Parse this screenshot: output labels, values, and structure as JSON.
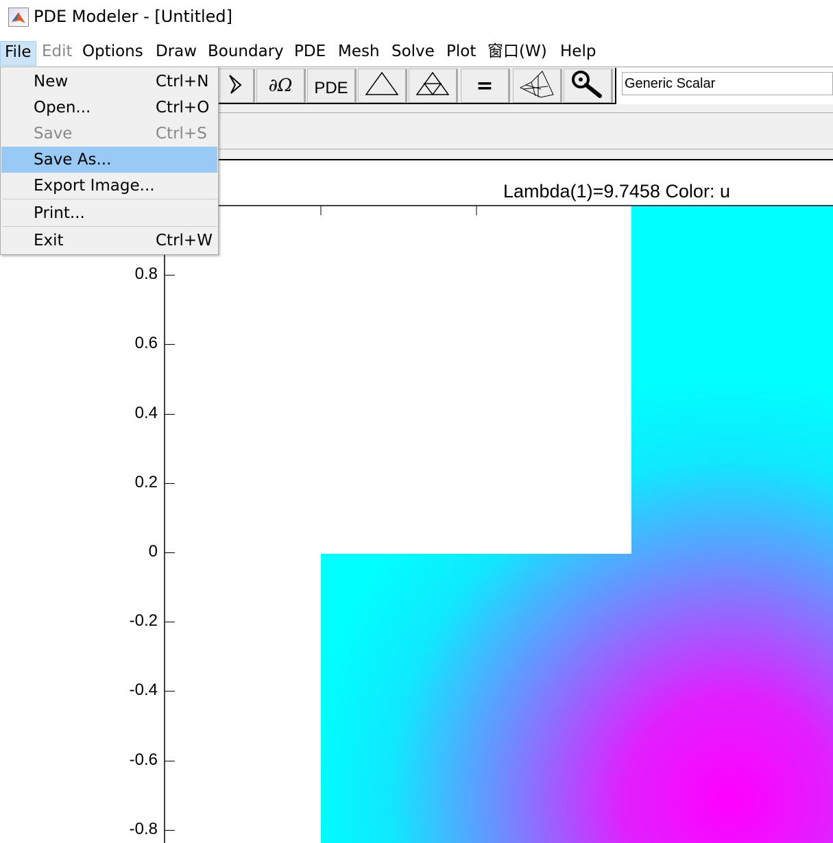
{
  "window": {
    "title": "PDE Modeler - [Untitled]"
  },
  "menubar": {
    "items": [
      {
        "label": "File",
        "state": "active"
      },
      {
        "label": "Edit",
        "state": "disabled"
      },
      {
        "label": "Options"
      },
      {
        "label": "Draw"
      },
      {
        "label": "Boundary"
      },
      {
        "label": "PDE"
      },
      {
        "label": "Mesh"
      },
      {
        "label": "Solve"
      },
      {
        "label": "Plot"
      },
      {
        "label": "窗口(W)"
      },
      {
        "label": "Help"
      }
    ]
  },
  "file_menu": {
    "items": [
      {
        "label": "New",
        "shortcut": "Ctrl+N"
      },
      {
        "label": "Open...",
        "shortcut": "Ctrl+O"
      },
      {
        "label": "Save",
        "shortcut": "Ctrl+S",
        "disabled": true
      },
      {
        "label": "Save As...",
        "highlighted": true
      },
      {
        "label": "Export Image..."
      },
      {
        "label": "Print..."
      },
      {
        "label": "Exit",
        "shortcut": "Ctrl+W"
      }
    ]
  },
  "toolbar": {
    "buttons": [
      {
        "icon": "polygon-icon"
      },
      {
        "icon": "boundary-icon",
        "label": "∂Ω"
      },
      {
        "label": "PDE"
      },
      {
        "icon": "mesh-triangle-icon"
      },
      {
        "icon": "refine-mesh-icon"
      },
      {
        "icon": "solve-equals-icon",
        "label": "="
      },
      {
        "icon": "plot-surface-icon"
      },
      {
        "icon": "zoom-icon"
      }
    ],
    "application_mode": "Generic Scalar"
  },
  "plot": {
    "title": "Lambda(1)=9.7458   Color: u",
    "y_ticks": [
      "0.8",
      "0.6",
      "0.4",
      "0.2",
      "0",
      "-0.2",
      "-0.4",
      "-0.6",
      "-0.8"
    ],
    "colormap": {
      "low": "#00ffff",
      "high": "#ff00ff"
    }
  }
}
